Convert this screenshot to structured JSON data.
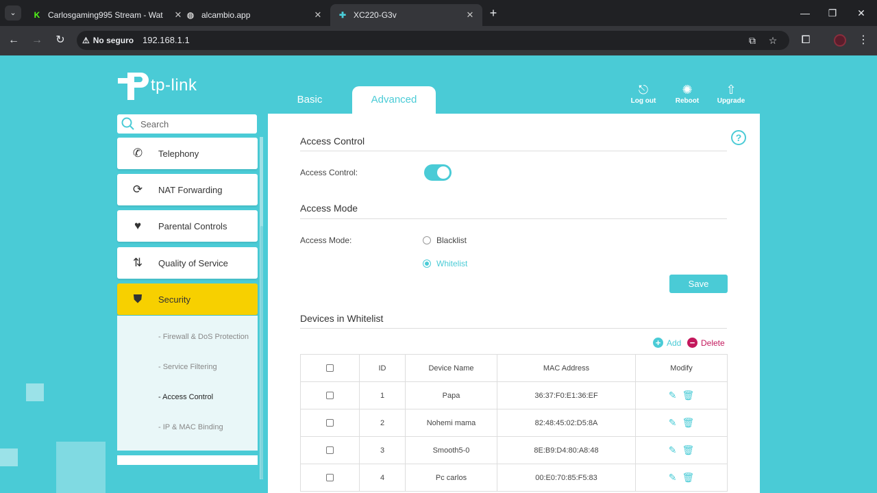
{
  "browser": {
    "tabs": [
      {
        "title": "Carlosgaming995 Stream - Wat",
        "favicon": "kick-icon",
        "active": false
      },
      {
        "title": "alcambio.app",
        "favicon": "globe-icon",
        "active": false
      },
      {
        "title": "XC220-G3v",
        "favicon": "tplink-icon",
        "active": true
      }
    ],
    "security_label": "No seguro",
    "url": "192.168.1.1"
  },
  "header": {
    "logo_text": "tp-link",
    "tabs": [
      {
        "label": "Basic",
        "active": false
      },
      {
        "label": "Advanced",
        "active": true
      }
    ],
    "actions": [
      {
        "label": "Log out",
        "icon": "logout-icon"
      },
      {
        "label": "Reboot",
        "icon": "reboot-icon"
      },
      {
        "label": "Upgrade",
        "icon": "upgrade-icon"
      }
    ]
  },
  "sidebar": {
    "search_placeholder": "Search",
    "items": [
      {
        "label": "Telephony",
        "icon": "phone-icon"
      },
      {
        "label": "NAT Forwarding",
        "icon": "nat-icon"
      },
      {
        "label": "Parental Controls",
        "icon": "heart-icon"
      },
      {
        "label": "Quality of Service",
        "icon": "qos-icon"
      },
      {
        "label": "Security",
        "icon": "shield-icon",
        "active": true
      }
    ],
    "sub_items": [
      {
        "label": "- Firewall & DoS Protection",
        "active": false
      },
      {
        "label": "- Service Filtering",
        "active": false
      },
      {
        "label": "- Access Control",
        "active": true
      },
      {
        "label": "- IP & MAC Binding",
        "active": false
      }
    ]
  },
  "main": {
    "access_control_title": "Access Control",
    "access_control_label": "Access Control:",
    "access_control_enabled": true,
    "access_mode_title": "Access Mode",
    "access_mode_label": "Access Mode:",
    "modes": [
      {
        "label": "Blacklist",
        "selected": false
      },
      {
        "label": "Whitelist",
        "selected": true
      }
    ],
    "save_label": "Save",
    "devices_title": "Devices in Whitelist",
    "add_label": "Add",
    "delete_label": "Delete",
    "table": {
      "headers": [
        "ID",
        "Device Name",
        "MAC Address",
        "Modify"
      ],
      "rows": [
        {
          "id": "1",
          "name": "Papa",
          "mac": "36:37:F0:E1:36:EF"
        },
        {
          "id": "2",
          "name": "Nohemi mama",
          "mac": "82:48:45:02:D5:8A"
        },
        {
          "id": "3",
          "name": "Smooth5-0",
          "mac": "8E:B9:D4:80:A8:48"
        },
        {
          "id": "4",
          "name": "Pc carlos",
          "mac": "00:E0:70:85:F5:83"
        }
      ]
    }
  },
  "colors": {
    "accent": "#4acbd6",
    "active_nav": "#f7d000",
    "delete": "#c3185c"
  }
}
